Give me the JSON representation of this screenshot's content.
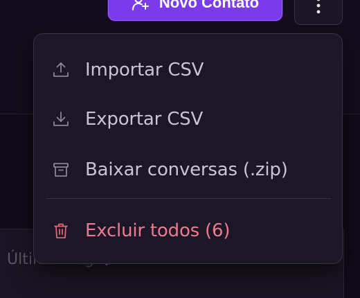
{
  "header": {
    "primary_button_label": "Novo Contato"
  },
  "table": {
    "column_header": "Última msg"
  },
  "menu": {
    "items": [
      {
        "label": "Importar CSV",
        "icon": "upload-icon"
      },
      {
        "label": "Exportar CSV",
        "icon": "download-icon"
      },
      {
        "label": "Baixar conversas (.zip)",
        "icon": "archive-icon"
      },
      {
        "label": "Excluir todos (6)",
        "icon": "trash-icon",
        "variant": "danger"
      }
    ]
  },
  "colors": {
    "accent": "#7c3aed",
    "danger": "#f07a8a",
    "menu_background": "#1c1728",
    "page_background": "#120d1c"
  }
}
